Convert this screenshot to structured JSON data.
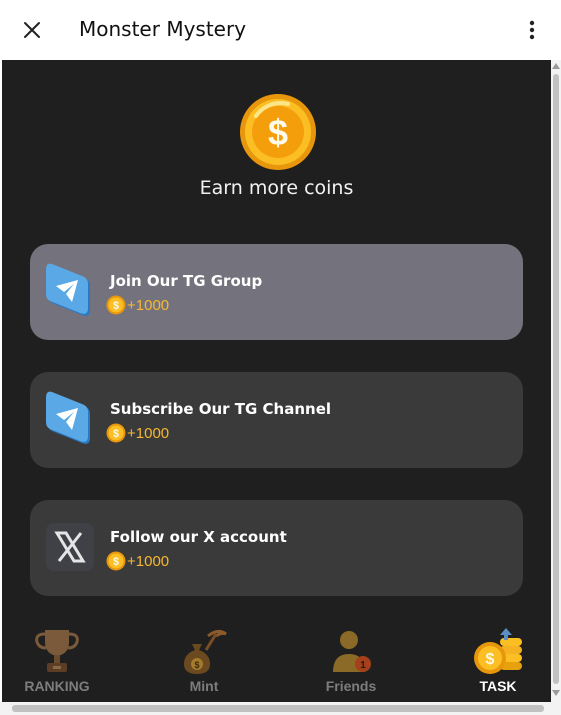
{
  "header": {
    "title": "Monster Mystery"
  },
  "hero": {
    "subtitle": "Earn more coins"
  },
  "tasks": [
    {
      "title": "Join Our TG Group",
      "reward": "+1000",
      "icon": "telegram-icon"
    },
    {
      "title": "Subscribe Our TG Channel",
      "reward": "+1000",
      "icon": "telegram-icon"
    },
    {
      "title": "Follow our X account",
      "reward": "+1000",
      "icon": "x-logo-icon"
    }
  ],
  "nav": {
    "items": [
      {
        "label": "RANKING",
        "icon": "trophy-icon"
      },
      {
        "label": "Mint",
        "icon": "money-bag-pickaxe-icon"
      },
      {
        "label": "Friends",
        "icon": "user-badge-icon"
      },
      {
        "label": "TASK",
        "icon": "coin-stack-icon"
      }
    ],
    "active": "TASK"
  },
  "colors": {
    "background": "#1f1f1f",
    "card": "#3a3a3a",
    "card_active": "#74737d",
    "reward": "#f7b731",
    "coin": "#f5b324"
  }
}
